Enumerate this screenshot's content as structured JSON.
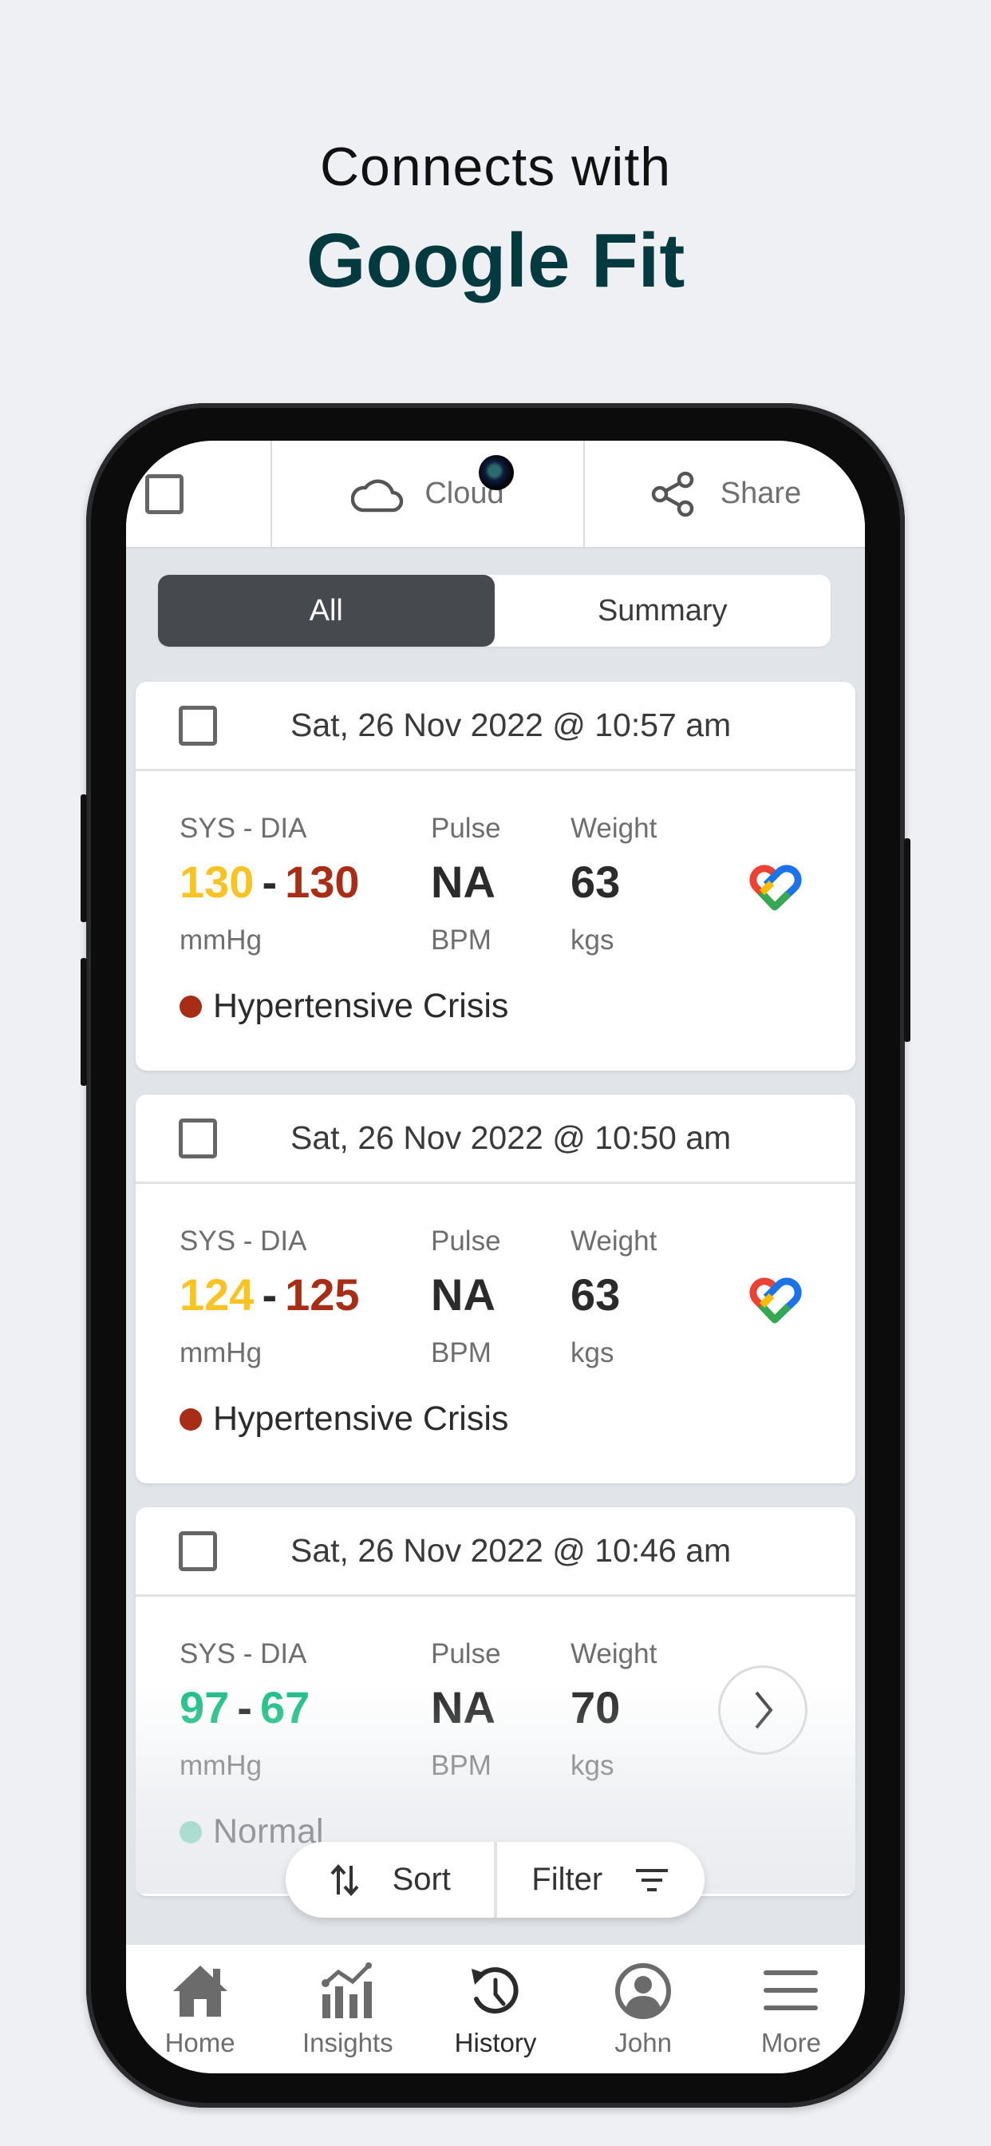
{
  "headline": {
    "line1": "Connects with",
    "line2": "Google Fit"
  },
  "topbar": {
    "cloud_label": "Cloud",
    "share_label": "Share"
  },
  "segmented": {
    "options": [
      "All",
      "Summary"
    ],
    "selected": "All"
  },
  "labels": {
    "bp": "SYS - DIA",
    "pulse": "Pulse",
    "weight": "Weight",
    "bp_unit": "mmHg",
    "pulse_unit": "BPM",
    "weight_unit": "kgs",
    "dash": "-"
  },
  "records": [
    {
      "date": "Sat, 26 Nov 2022 @ 10:57 am",
      "sys": "130",
      "dia": "130",
      "sys_color": "#f7c325",
      "dia_color": "#a72d17",
      "pulse": "NA",
      "weight": "63",
      "status": "Hypertensive Crisis",
      "status_color": "#a72d17",
      "source_icon": "google-fit-icon"
    },
    {
      "date": "Sat, 26 Nov 2022 @ 10:50 am",
      "sys": "124",
      "dia": "125",
      "sys_color": "#f7c325",
      "dia_color": "#a72d17",
      "pulse": "NA",
      "weight": "63",
      "status": "Hypertensive Crisis",
      "status_color": "#a72d17",
      "source_icon": "google-fit-icon"
    },
    {
      "date": "Sat, 26 Nov 2022 @ 10:46 am",
      "sys": "97",
      "dia": "67",
      "sys_color": "#1fbf86",
      "dia_color": "#1fbf86",
      "pulse": "NA",
      "weight": "70",
      "status": "Normal",
      "status_color": "#5fd3ad",
      "source_icon": "chevron-right-icon"
    }
  ],
  "actions": {
    "sort_label": "Sort",
    "filter_label": "Filter"
  },
  "bottom_nav": [
    {
      "label": "Home",
      "icon": "home-icon"
    },
    {
      "label": "Insights",
      "icon": "insights-icon"
    },
    {
      "label": "History",
      "icon": "history-icon",
      "active": true
    },
    {
      "label": "John",
      "icon": "profile-icon"
    },
    {
      "label": "More",
      "icon": "menu-icon"
    }
  ]
}
